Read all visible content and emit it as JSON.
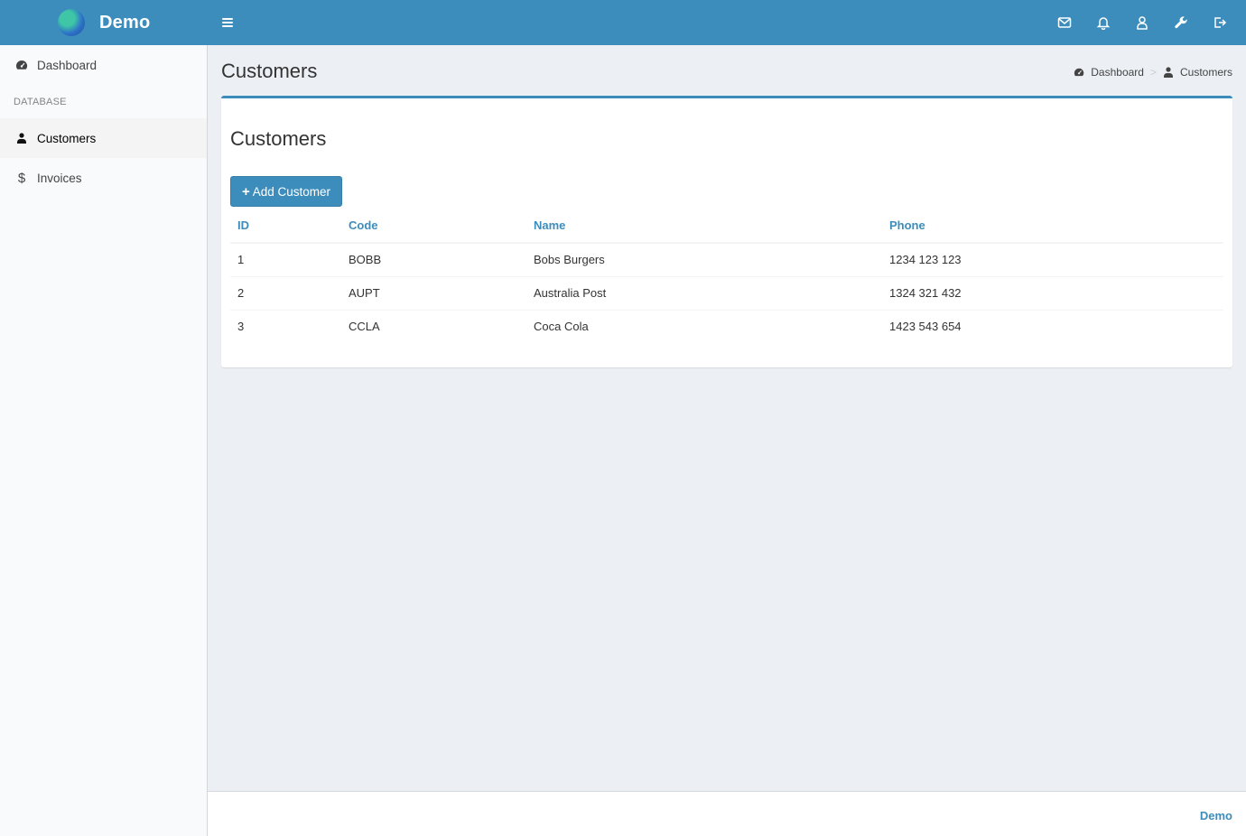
{
  "header": {
    "brand": "Demo",
    "icons": [
      "envelope-icon",
      "bell-icon",
      "user-icon",
      "wrench-icon",
      "sign-out-icon"
    ]
  },
  "sidebar": {
    "items": [
      {
        "label": "Dashboard",
        "icon": "tachometer-icon"
      },
      {
        "section": "DATABASE"
      },
      {
        "label": "Customers",
        "icon": "user-icon",
        "active": true
      },
      {
        "label": "Invoices",
        "icon": "dollar-icon"
      }
    ]
  },
  "page": {
    "title": "Customers",
    "breadcrumb": [
      {
        "label": "Dashboard",
        "icon": "tachometer-icon"
      },
      {
        "label": "Customers",
        "icon": "user-icon"
      }
    ]
  },
  "box": {
    "title": "Customers",
    "add_button": "Add Customer",
    "table": {
      "columns": [
        "ID",
        "Code",
        "Name",
        "Phone"
      ],
      "rows": [
        [
          "1",
          "BOBB",
          "Bobs Burgers",
          "1234 123 123"
        ],
        [
          "2",
          "AUPT",
          "Australia Post",
          "1324 321 432"
        ],
        [
          "3",
          "CCLA",
          "Coca Cola",
          "1423 543 654"
        ]
      ]
    }
  },
  "footer": {
    "link": "Demo"
  },
  "colors": {
    "primary": "#3c8dbc",
    "background": "#ecf0f5",
    "sidebar": "#f9fafc"
  }
}
